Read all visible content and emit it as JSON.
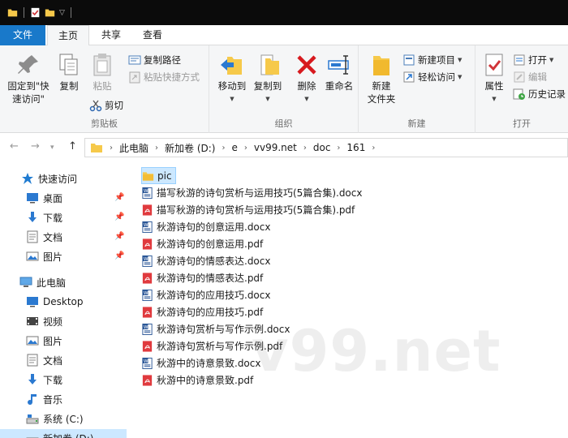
{
  "ribbon_tabs": {
    "file": "文件",
    "home": "主页",
    "share": "共享",
    "view": "查看"
  },
  "ribbon": {
    "clipboard": {
      "pin_label_1": "固定到\"快",
      "pin_label_2": "速访问\"",
      "copy": "复制",
      "paste": "粘贴",
      "copy_path": "复制路径",
      "paste_shortcut": "粘贴快捷方式",
      "cut": "剪切",
      "group": "剪贴板"
    },
    "organize": {
      "move_to": "移动到",
      "copy_to": "复制到",
      "delete": "删除",
      "rename": "重命名",
      "group": "组织"
    },
    "new": {
      "new_folder_1": "新建",
      "new_folder_2": "文件夹",
      "new_item": "新建项目",
      "easy_access": "轻松访问",
      "group": "新建"
    },
    "open": {
      "properties": "属性",
      "open": "打开",
      "edit": "编辑",
      "history": "历史记录",
      "group": "打开"
    }
  },
  "breadcrumb": [
    "此电脑",
    "新加卷 (D:)",
    "e",
    "vv99.net",
    "doc",
    "161"
  ],
  "sidebar": {
    "quick_access": "快速访问",
    "quick_items": [
      "桌面",
      "下载",
      "文档",
      "图片"
    ],
    "this_pc": "此电脑",
    "pc_items": [
      "Desktop",
      "视频",
      "图片",
      "文档",
      "下载",
      "音乐",
      "系统 (C:)",
      "新加卷 (D:)"
    ]
  },
  "files": [
    {
      "name": "pic",
      "type": "folder"
    },
    {
      "name": "描写秋游的诗句赏析与运用技巧(5篇合集).docx",
      "type": "docx"
    },
    {
      "name": "描写秋游的诗句赏析与运用技巧(5篇合集).pdf",
      "type": "pdf"
    },
    {
      "name": "秋游诗句的创意运用.docx",
      "type": "docx"
    },
    {
      "name": "秋游诗句的创意运用.pdf",
      "type": "pdf"
    },
    {
      "name": "秋游诗句的情感表达.docx",
      "type": "docx"
    },
    {
      "name": "秋游诗句的情感表达.pdf",
      "type": "pdf"
    },
    {
      "name": "秋游诗句的应用技巧.docx",
      "type": "docx"
    },
    {
      "name": "秋游诗句的应用技巧.pdf",
      "type": "pdf"
    },
    {
      "name": "秋游诗句赏析与写作示例.docx",
      "type": "docx"
    },
    {
      "name": "秋游诗句赏析与写作示例.pdf",
      "type": "pdf"
    },
    {
      "name": "秋游中的诗意景致.docx",
      "type": "docx"
    },
    {
      "name": "秋游中的诗意景致.pdf",
      "type": "pdf"
    }
  ],
  "watermark": "v99.net",
  "colors": {
    "accent": "#1979ca",
    "selection": "#cce8ff",
    "folder": "#f6c94a",
    "pdf": "#e03a3e",
    "docx": "#2b5797"
  }
}
